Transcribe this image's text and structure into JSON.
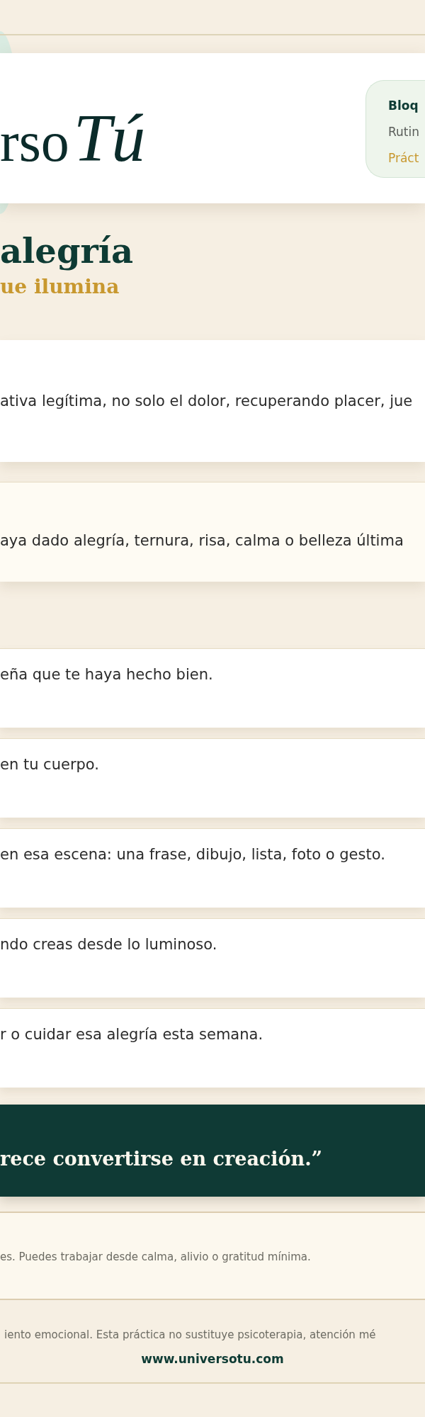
{
  "header": {
    "logo": {
      "wordmark": "rso",
      "script": "Tú"
    },
    "info_badge": {
      "lines": [
        {
          "kind": "title",
          "text": "Bloq"
        },
        {
          "kind": "subtitle",
          "text": "Rutin"
        },
        {
          "kind": "accent",
          "text": "Práct"
        }
      ]
    }
  },
  "title": "alegría",
  "subtitle": "ue ilumina",
  "intro_card": {
    "text": "ativa legítima, no solo el dolor, recuperando placer, jue"
  },
  "highlight_card": {
    "text": "aya dado alegría, ternura, risa, calma o belleza última"
  },
  "prompts": [
    {
      "text": "eña que te haya hecho bien."
    },
    {
      "text": "en tu cuerpo."
    },
    {
      "text": "en esa escena: una frase, dibujo, lista, foto o gesto."
    },
    {
      "text": "ndo creas desde lo luminoso."
    },
    {
      "text": "r o cuidar esa alegría esta semana."
    }
  ],
  "quote": "rece convertirse en creación.”",
  "note": "es. Puedes trabajar desde calma, alivio o gratitud mínima.",
  "footer": {
    "disclaimer": "iento emocional. Esta práctica no sustituye psicoterapia, atención mé",
    "website": "www.universotu.com"
  }
}
